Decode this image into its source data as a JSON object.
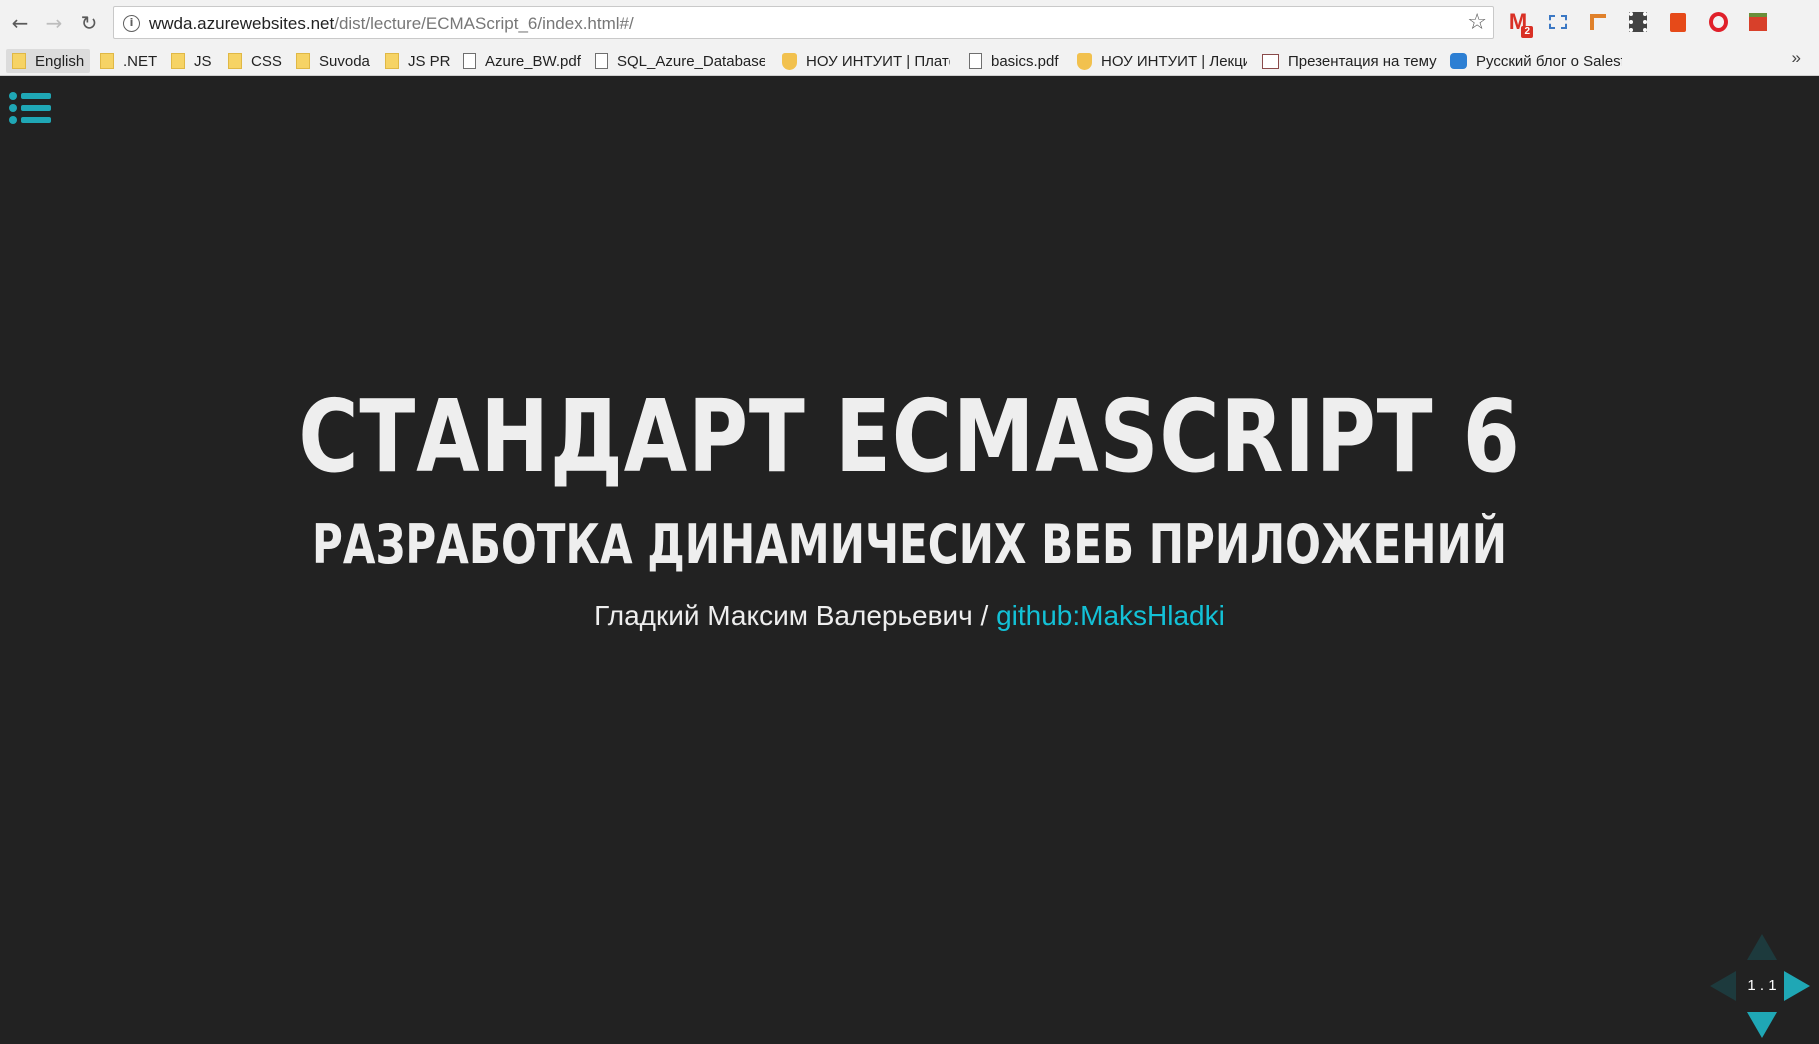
{
  "browser": {
    "url_host": "wwda.azurewebsites.net",
    "url_path": "/dist/lecture/ECMAScript_6/index.html#/",
    "info_icon": "info-icon",
    "gmail_badge": "2",
    "bookmarks": [
      {
        "label": "English",
        "icon": "folder-icon"
      },
      {
        "label": ".NET",
        "icon": "folder-icon"
      },
      {
        "label": "JS",
        "icon": "folder-icon"
      },
      {
        "label": "CSS",
        "icon": "folder-icon"
      },
      {
        "label": "Suvoda",
        "icon": "folder-icon"
      },
      {
        "label": "JS PR",
        "icon": "folder-icon"
      },
      {
        "label": "Azure_BW.pdf",
        "icon": "document-icon"
      },
      {
        "label": "SQL_Azure_Database.",
        "icon": "document-icon"
      },
      {
        "label": "НОУ ИНТУИТ | Платф",
        "icon": "shield-icon"
      },
      {
        "label": "basics.pdf",
        "icon": "document-icon"
      },
      {
        "label": "НОУ ИНТУИТ | Лекци",
        "icon": "shield-icon"
      },
      {
        "label": "Презентация на тему",
        "icon": "slide-icon"
      },
      {
        "label": "Русский блог о Salesf",
        "icon": "globe-icon"
      }
    ],
    "more_bookmarks": "»"
  },
  "slide": {
    "title": "СТАНДАРТ ECMASCRIPT 6",
    "subtitle": "РАЗРАБОТКА ДИНАМИЧЕСИХ ВЕБ ПРИЛОЖЕНИЙ",
    "author": "Гладкий Максим Валерьевич / ",
    "github_link": "github:MaksHladki"
  },
  "controls": {
    "slide_number": "1 . 1"
  },
  "colors": {
    "background": "#222222",
    "accent": "#1fa7b5",
    "link": "#13c1d6",
    "text": "#eeeeee"
  }
}
